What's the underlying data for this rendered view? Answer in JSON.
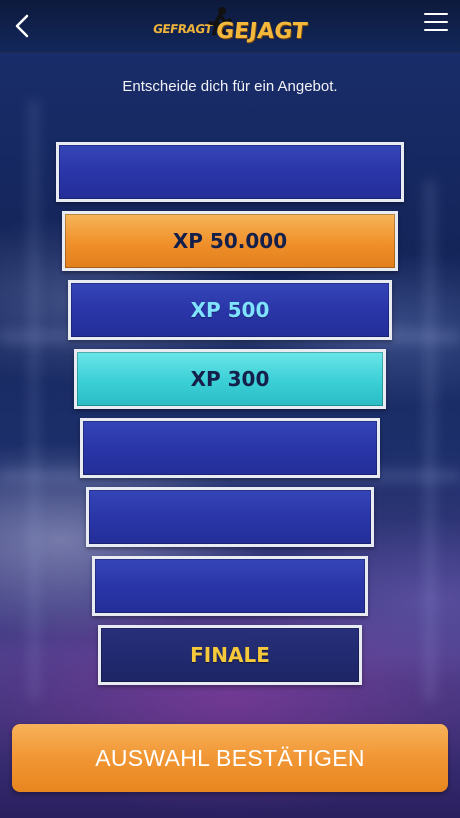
{
  "header": {
    "logo_small": "GEFRAGT",
    "logo_large": "GEJAGT"
  },
  "instruction": "Entscheide dich für ein Angebot.",
  "ladder": [
    {
      "label": ""
    },
    {
      "label": "XP 50.000"
    },
    {
      "label": "XP 500"
    },
    {
      "label": "XP 300"
    },
    {
      "label": ""
    },
    {
      "label": ""
    },
    {
      "label": ""
    },
    {
      "label": "FINALE"
    }
  ],
  "confirm_label": "AUSWAHL BESTÄTIGEN",
  "colors": {
    "header_bg": "#0d1a3d",
    "step_blue": "#2a36a8",
    "step_orange": "#f0902a",
    "step_cyan": "#3bcfd6",
    "finale_text": "#f5c93a",
    "confirm_bg": "#f19634"
  },
  "icons": {
    "back": "chevron-left-icon",
    "menu": "hamburger-menu-icon"
  }
}
